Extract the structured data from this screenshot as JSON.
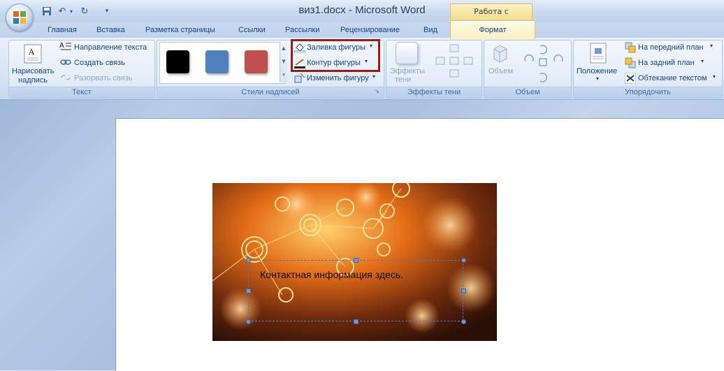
{
  "window": {
    "title": "виз1.docx - Microsoft Word"
  },
  "context_tab": {
    "header": "Работа с надписями",
    "tab": "Формат"
  },
  "tabs": [
    "Главная",
    "Вставка",
    "Разметка страницы",
    "Ссылки",
    "Рассылки",
    "Рецензирование",
    "Вид"
  ],
  "groups": {
    "text": {
      "label": "Текст",
      "draw_textbox": [
        "Нарисовать",
        "надпись"
      ],
      "text_direction": "Направление текста",
      "create_link": "Создать связь",
      "break_link": "Разорвать связь"
    },
    "styles": {
      "label": "Стили надписей",
      "shape_fill": "Заливка фигуры",
      "shape_outline": "Контур фигуры",
      "change_shape": "Изменить фигуру",
      "swatches": [
        "#000000",
        "#4f81bd",
        "#c0504d"
      ]
    },
    "shadow": {
      "label": "Эффекты тени",
      "button": [
        "Эффекты",
        "тени"
      ]
    },
    "volume": {
      "label": "Объем",
      "button": "Объем"
    },
    "arrange": {
      "label": "Упорядочить",
      "position": "Положение",
      "bring_front": "На передний план",
      "send_back": "На задний план",
      "wrap": "Обтекание текстом"
    }
  },
  "document": {
    "textbox_text": "Контактная информация здесь."
  },
  "colors": {
    "highlight": "#a11a1a",
    "accent": "#15428b"
  }
}
